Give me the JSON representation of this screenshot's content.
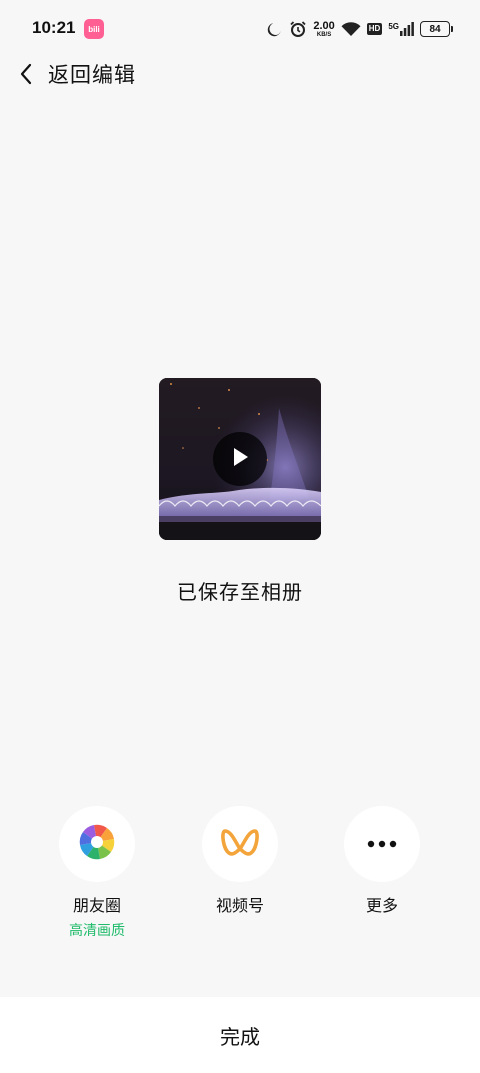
{
  "status_bar": {
    "time": "10:21",
    "app_badge": "bili",
    "net_speed_value": "2.00",
    "net_speed_unit": "KB/S",
    "hd_label": "HD",
    "network_label": "5G",
    "battery": "84"
  },
  "nav": {
    "back_label": "返回编辑"
  },
  "preview": {
    "saved_text": "已保存至相册"
  },
  "share": {
    "items": [
      {
        "label": "朋友圈",
        "sub": "高清画质",
        "icon": "moments-icon"
      },
      {
        "label": "视频号",
        "icon": "channels-icon"
      },
      {
        "label": "更多",
        "icon": "more-icon"
      }
    ],
    "sub_color": "#1fbb6a"
  },
  "footer": {
    "done_label": "完成"
  }
}
